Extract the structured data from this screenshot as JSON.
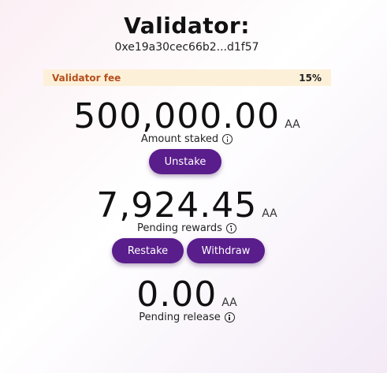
{
  "header": {
    "title": "Validator:",
    "address": "0xe19a30cec66b2...d1f57"
  },
  "fee": {
    "label": "Validator fee",
    "value": "15%"
  },
  "staked": {
    "amount": "500,000.00",
    "unit": "AA",
    "caption": "Amount staked",
    "unstake_label": "Unstake"
  },
  "rewards": {
    "amount": "7,924.45",
    "unit": "AA",
    "caption": "Pending rewards",
    "restake_label": "Restake",
    "withdraw_label": "Withdraw"
  },
  "release": {
    "amount": "0.00",
    "unit": "AA",
    "caption": "Pending release"
  },
  "colors": {
    "button": "#5a1d8c",
    "fee_background": "#fdf0d9",
    "fee_label": "#b5501c"
  },
  "icons": [
    "info-icon"
  ]
}
